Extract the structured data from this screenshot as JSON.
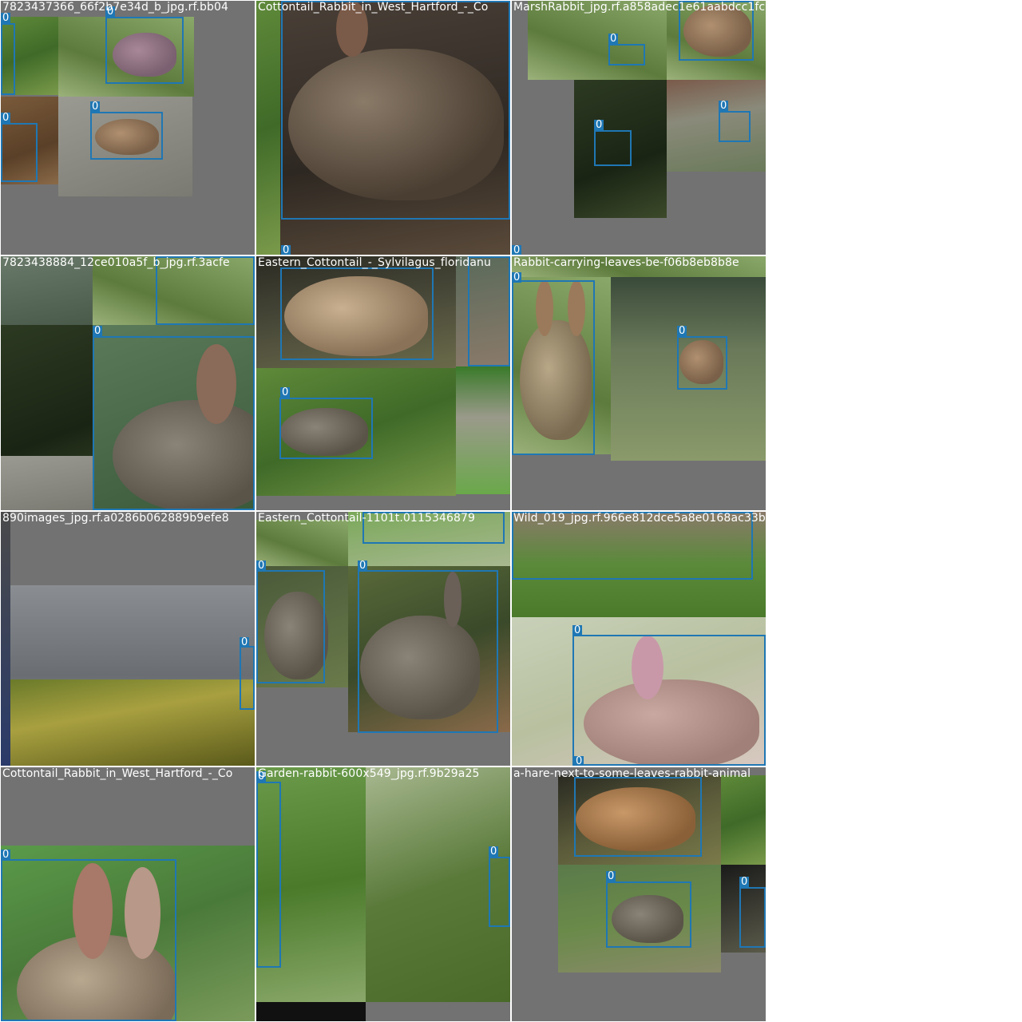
{
  "tiles": [
    {
      "title": "7823437366_66f2b7e34d_b_jpg.rf.bb04",
      "labels": [
        "0",
        "0",
        "0",
        "0"
      ]
    },
    {
      "title": "Cottontail_Rabbit_in_West_Hartford_-_Co",
      "labels": [
        "0"
      ]
    },
    {
      "title": "MarshRabbit_jpg.rf.a858adec1e61aabdcc1fc",
      "labels": [
        "0",
        "0",
        "0",
        "0"
      ]
    },
    {
      "title": "7823438884_12ce010a5f_b_jpg.rf.3acfe",
      "labels": [
        "0",
        "0"
      ]
    },
    {
      "title": "Eastern_Cottontail_-_Sylvilagus_floridanu",
      "labels": [
        "0",
        "0"
      ]
    },
    {
      "title": "Rabbit-carrying-leaves-be-f06b8eb8b8e",
      "labels": [
        "0",
        "0"
      ]
    },
    {
      "title": "890images_jpg.rf.a0286b062889b9efe8",
      "labels": [
        "0"
      ]
    },
    {
      "title": "Eastern_Cottontail-1101t.0115346879",
      "labels": [
        "0",
        "0",
        "0"
      ]
    },
    {
      "title": "Wild_019_jpg.rf.966e812dce5a8e0168ac33b1",
      "labels": [
        "0",
        "0"
      ]
    },
    {
      "title": "Cottontail_Rabbit_in_West_Hartford_-_Co",
      "labels": [
        "0"
      ]
    },
    {
      "title": "Garden-rabbit-600x549_jpg.rf.9b29a25",
      "labels": [
        "0",
        "0"
      ]
    },
    {
      "title": "a-hare-next-to-some-leaves-rabbit-animal",
      "labels": [
        "0",
        "0",
        "0"
      ]
    }
  ],
  "colors": {
    "box": "#1f77b4",
    "pad": "#727272",
    "title": "#ffffff"
  }
}
